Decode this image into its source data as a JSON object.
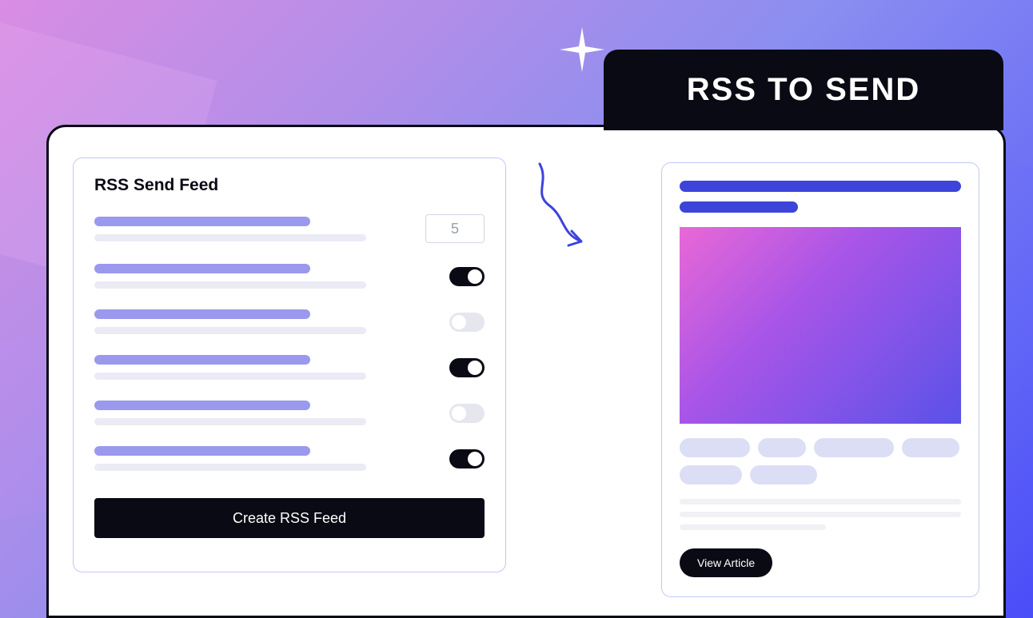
{
  "header": {
    "title": "RSS TO SEND"
  },
  "form": {
    "heading": "RSS Send Feed",
    "number_value": "5",
    "rows": [
      {
        "control": "number"
      },
      {
        "control": "toggle",
        "on": true
      },
      {
        "control": "toggle",
        "on": false
      },
      {
        "control": "toggle",
        "on": true
      },
      {
        "control": "toggle",
        "on": false
      },
      {
        "control": "toggle",
        "on": true
      }
    ],
    "submit_label": "Create RSS Feed"
  },
  "preview": {
    "view_article_label": "View Article"
  },
  "colors": {
    "accent": "#3d44da",
    "skeleton": "#9a99ed",
    "dark": "#0a0a14"
  }
}
